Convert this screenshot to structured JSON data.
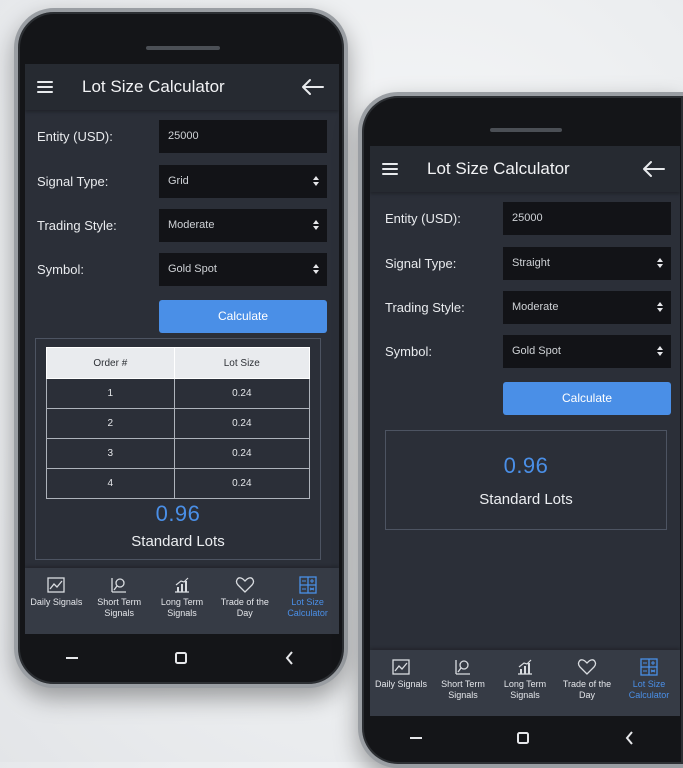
{
  "phones": [
    {
      "header": {
        "title": "Lot Size Calculator"
      },
      "form": [
        {
          "label": "Entity (USD):",
          "value": "25000",
          "dropdown": false
        },
        {
          "label": "Signal Type:",
          "value": "Grid",
          "dropdown": true
        },
        {
          "label": "Trading Style:",
          "value": "Moderate",
          "dropdown": true
        },
        {
          "label": "Symbol:",
          "value": "Gold Spot",
          "dropdown": true
        }
      ],
      "calculate_label": "Calculate",
      "table": {
        "headers": [
          "Order #",
          "Lot Size"
        ],
        "rows": [
          [
            "1",
            "0.24"
          ],
          [
            "2",
            "0.24"
          ],
          [
            "3",
            "0.24"
          ],
          [
            "4",
            "0.24"
          ]
        ]
      },
      "result": {
        "value": "0.96",
        "unit": "Standard Lots"
      }
    },
    {
      "header": {
        "title": "Lot Size Calculator"
      },
      "form": [
        {
          "label": "Entity (USD):",
          "value": "25000",
          "dropdown": false
        },
        {
          "label": "Signal Type:",
          "value": "Straight",
          "dropdown": true
        },
        {
          "label": "Trading Style:",
          "value": "Moderate",
          "dropdown": true
        },
        {
          "label": "Symbol:",
          "value": "Gold Spot",
          "dropdown": true
        }
      ],
      "calculate_label": "Calculate",
      "result": {
        "value": "0.96",
        "unit": "Standard Lots"
      }
    }
  ],
  "nav": [
    {
      "label": "Daily Signals",
      "icon": "chart-icon",
      "active": false
    },
    {
      "label": "Short Term Signals",
      "icon": "magnifier-chart-icon",
      "active": false
    },
    {
      "label": "Long Term Signals",
      "icon": "growth-chart-icon",
      "active": false
    },
    {
      "label": "Trade of the Day",
      "icon": "heart-icon",
      "active": false
    },
    {
      "label": "Lot Size Calculator",
      "icon": "calculator-icon",
      "active": true
    }
  ],
  "colors": {
    "accent": "#4a8fe7",
    "screen_bg": "#2b2f38",
    "field_bg": "#121317",
    "nav_bg": "#363b45"
  }
}
